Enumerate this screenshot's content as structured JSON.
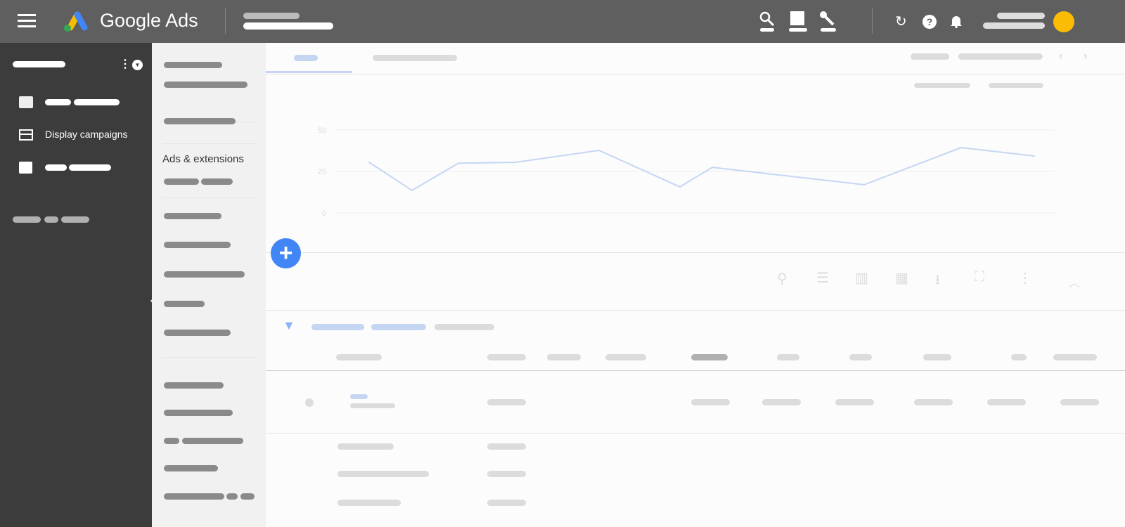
{
  "header": {
    "app_name": "Google Ads",
    "icons": [
      "menu-icon",
      "search-icon",
      "reports-icon",
      "tools-icon",
      "refresh-icon",
      "help-icon",
      "notifications-icon",
      "account-avatar"
    ]
  },
  "sidebar": {
    "items": [
      {
        "icon": "search-campaign-icon",
        "label": ""
      },
      {
        "icon": "display-icon",
        "label": "Display campaigns"
      },
      {
        "icon": "tag-icon",
        "label": ""
      }
    ]
  },
  "subnav": {
    "section_heading": "Ads & extensions"
  },
  "chart_data": {
    "type": "line",
    "title": "",
    "xlabel": "",
    "ylabel": "",
    "ylim": [
      0,
      50
    ],
    "yticks": [
      "50",
      "25",
      "0"
    ],
    "grid": true,
    "color": "#c5d6f3",
    "values": [
      30.5,
      13.6,
      30,
      30.5,
      37.7,
      15.7,
      27.5,
      17,
      39.4,
      34.3
    ]
  },
  "colors": {
    "header_bg": "#5f5f5f",
    "sidebar_bg": "#3c3c3c",
    "accent": "#4285f4"
  }
}
